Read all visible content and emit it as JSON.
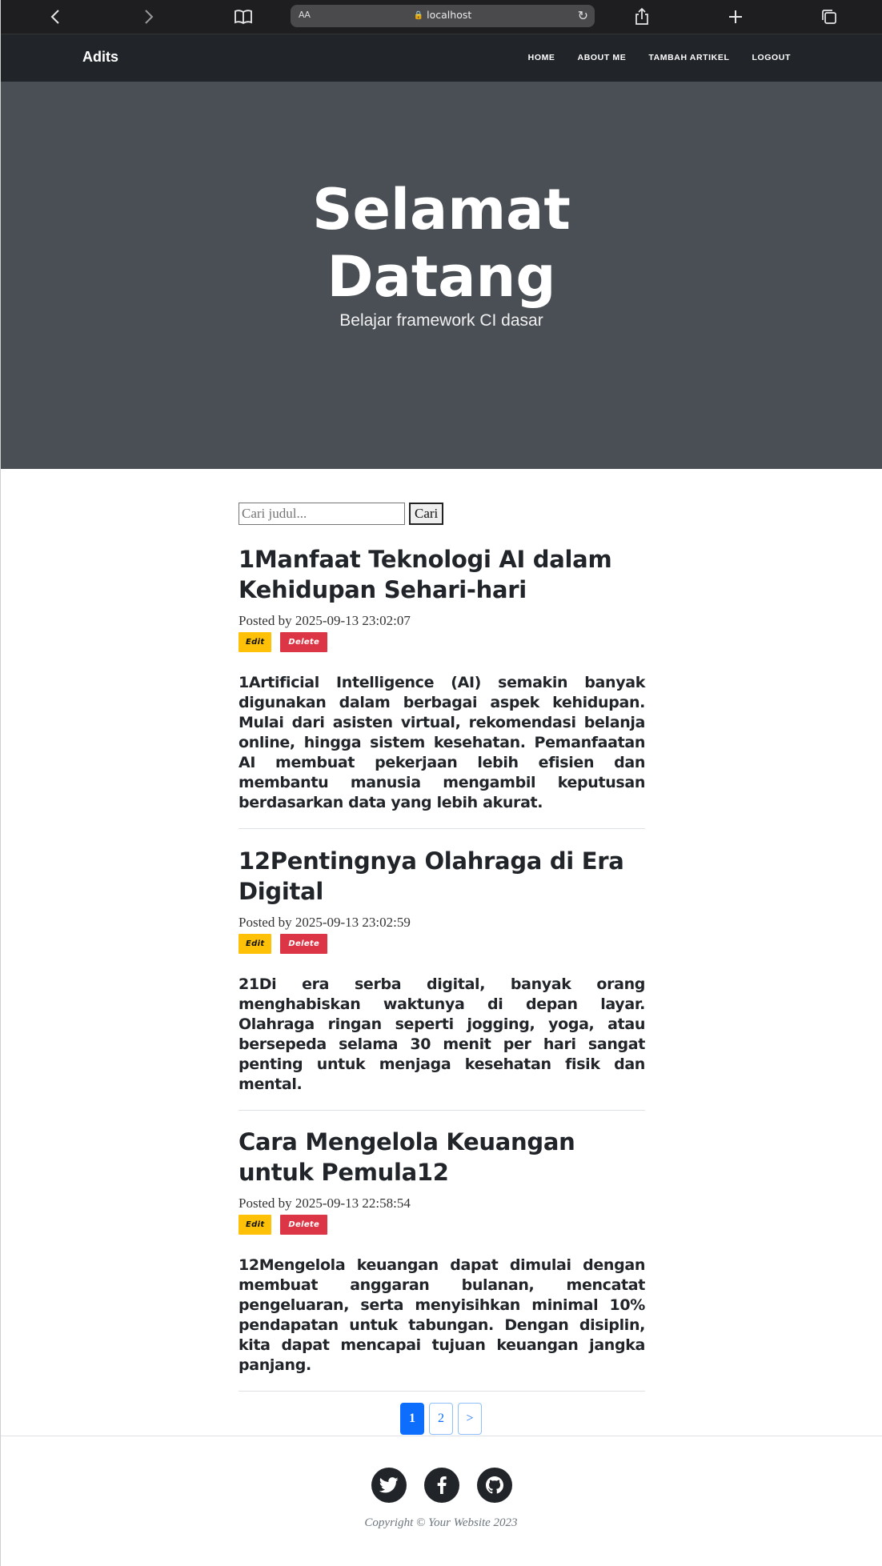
{
  "browser": {
    "url_text_size": "AA",
    "url": "localhost"
  },
  "navbar": {
    "brand": "Adits",
    "links": [
      "HOME",
      "ABOUT ME",
      "TAMBAH ARTIKEL",
      "LOGOUT"
    ]
  },
  "hero": {
    "title_line1": "Selamat",
    "title_line2": "Datang",
    "subtitle": "Belajar framework CI dasar"
  },
  "search": {
    "placeholder": "Cari judul...",
    "button": "Cari"
  },
  "posts": [
    {
      "title": "1Manfaat Teknologi AI dalam Kehidupan Sehari-hari",
      "meta": "Posted by 2025-09-13 23:02:07",
      "edit": "Edit",
      "delete": "Delete",
      "body": "1Artificial Intelligence (AI) semakin banyak digunakan dalam berbagai aspek kehidupan. Mulai dari asisten virtual, rekomendasi belanja online, hingga sistem kesehatan. Pemanfaatan AI membuat pekerjaan lebih efisien dan membantu manusia mengambil keputusan berdasarkan data yang lebih akurat."
    },
    {
      "title": "12Pentingnya Olahraga di Era Digital",
      "meta": "Posted by 2025-09-13 23:02:59",
      "edit": "Edit",
      "delete": "Delete",
      "body": "21Di era serba digital, banyak orang menghabiskan waktunya di depan layar. Olahraga ringan seperti jogging, yoga, atau bersepeda selama 30 menit per hari sangat penting untuk menjaga kesehatan fisik dan mental."
    },
    {
      "title": "Cara Mengelola Keuangan untuk Pemula12",
      "meta": "Posted by 2025-09-13 22:58:54",
      "edit": "Edit",
      "delete": "Delete",
      "body": "12Mengelola keuangan dapat dimulai dengan membuat anggaran bulanan, mencatat pengeluaran, serta menyisihkan minimal 10% pendapatan untuk tabungan. Dengan disiplin, kita dapat mencapai tujuan keuangan jangka panjang."
    }
  ],
  "pagination": {
    "pages": [
      "1",
      "2",
      ">"
    ],
    "active": "1"
  },
  "footer": {
    "social_icons": [
      "twitter-icon",
      "facebook-icon",
      "github-icon"
    ],
    "copyright": "Copyright © Your Website 2023"
  }
}
